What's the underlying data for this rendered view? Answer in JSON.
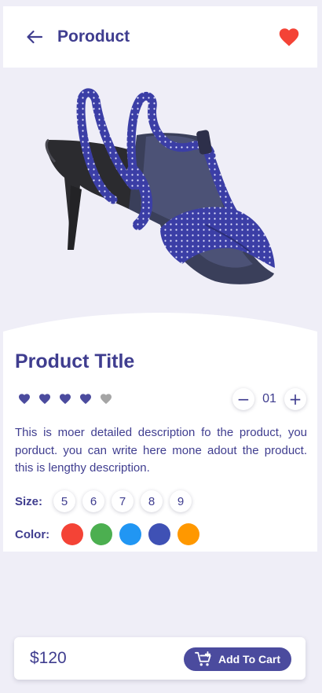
{
  "header": {
    "title": "Poroduct",
    "back_icon": "arrow-left-icon",
    "favorite_icon": "heart-icon",
    "favorite_color": "#f44336"
  },
  "product": {
    "title": "Product Title",
    "image": "high-heel-sandal-image",
    "rating": {
      "value": 4,
      "max": 5,
      "active_color": "#4b4b9e",
      "inactive_color": "#a5a5a5"
    },
    "quantity": {
      "value": "01",
      "minus_symbol": "−",
      "plus_symbol": "+"
    },
    "description": "This is moer detailed description fo the product, you porduct. you can write here mone adout the product. this is lengthy description.",
    "size_label": "Size:",
    "sizes": [
      "5",
      "6",
      "7",
      "8",
      "9"
    ],
    "color_label": "Color:",
    "colors": [
      "#f44336",
      "#4caf50",
      "#2196f3",
      "#3f51b5",
      "#ff9800"
    ]
  },
  "footer": {
    "price": "$120",
    "add_to_cart_label": "Add To Cart",
    "cart_icon": "cart-plus-icon"
  }
}
